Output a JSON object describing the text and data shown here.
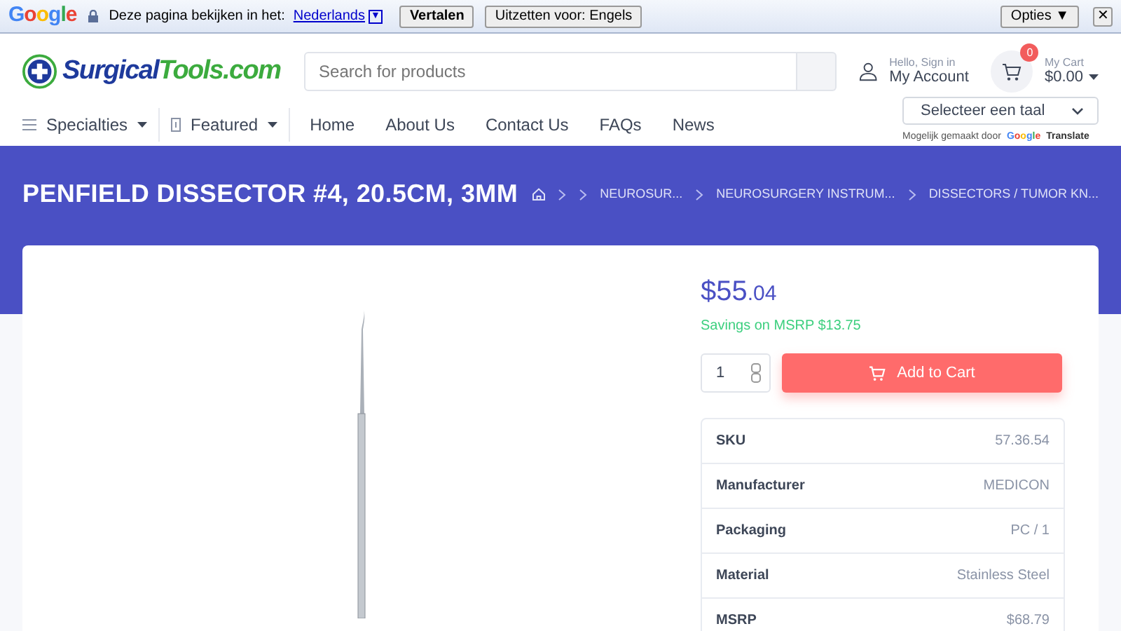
{
  "translate_bar": {
    "logo": "Google",
    "prompt": "Deze pagina bekijken in het:",
    "language": "Nederlands",
    "language_arrow": "▼",
    "translate_button": "Vertalen",
    "disable_button": "Uitzetten voor: Engels",
    "options_button": "Opties ▼",
    "close": "✕"
  },
  "header": {
    "logo": {
      "part_1": "Surgical",
      "part_2": "Tools.com"
    },
    "search": {
      "placeholder": "Search for products"
    },
    "account": {
      "greeting": "Hello, Sign in",
      "label": "My Account"
    },
    "cart": {
      "count": "0",
      "label": "My Cart",
      "total": "$0.00"
    }
  },
  "nav": {
    "menus": [
      {
        "label": "Specialties",
        "kind": "dropdown"
      },
      {
        "label": "Featured",
        "kind": "dropdown"
      },
      {
        "label": "Home",
        "kind": "link"
      },
      {
        "label": "About Us",
        "kind": "link"
      },
      {
        "label": "Contact Us",
        "kind": "link"
      },
      {
        "label": "FAQs",
        "kind": "link"
      },
      {
        "label": "News",
        "kind": "link"
      }
    ],
    "language_select": "Selecteer een taal",
    "powered_by": "Mogelijk gemaakt door",
    "powered_logo": "Google",
    "powered_product": "Translate"
  },
  "page_title": "PENFIELD DISSECTOR #4, 20.5CM, 3MM",
  "breadcrumb": [
    "NEUROSUR...",
    "NEUROSURGERY INSTRUM...",
    "DISSECTORS / TUMOR KN..."
  ],
  "product": {
    "price_main": "$55",
    "price_cents": ".04",
    "savings": "Savings on MSRP $13.75",
    "quantity": "1",
    "add_to_cart": "Add to Cart",
    "specs": [
      {
        "label": "SKU",
        "value": "57.36.54"
      },
      {
        "label": "Manufacturer",
        "value": "MEDICON"
      },
      {
        "label": "Packaging",
        "value": "PC / 1"
      },
      {
        "label": "Material",
        "value": "Stainless Steel"
      },
      {
        "label": "MSRP",
        "value": "$68.79"
      }
    ]
  }
}
